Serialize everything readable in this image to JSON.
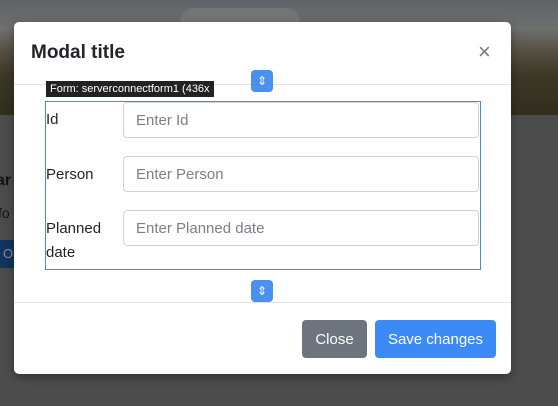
{
  "background": {
    "heading_fragment": "ar",
    "text_fragment": "fo",
    "button_fragment": "O"
  },
  "modal": {
    "title": "Modal title",
    "close_glyph": "×"
  },
  "form": {
    "tag_label": "Form: serverconnectform1 (436x",
    "resize_glyph": "⇕",
    "fields": [
      {
        "label": "Id",
        "placeholder": "Enter Id"
      },
      {
        "label": "Person",
        "placeholder": "Enter Person"
      },
      {
        "label": "Planned date",
        "label_line1": "Planned",
        "label_line2": "date",
        "placeholder": "Enter Planned date"
      }
    ]
  },
  "footer": {
    "close_label": "Close",
    "save_label": "Save changes"
  },
  "colors": {
    "primary": "#3b8af5",
    "secondary": "#6c757d",
    "selection_border": "#4a8ad0"
  }
}
